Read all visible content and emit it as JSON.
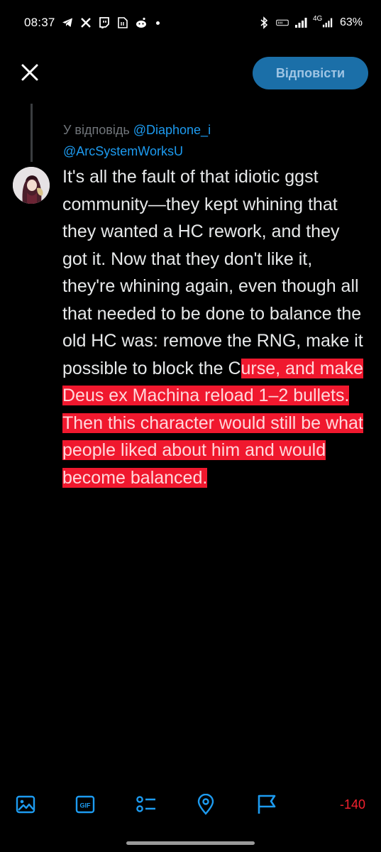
{
  "status": {
    "time": "08:37",
    "network": "4G",
    "battery": "63%",
    "left_icons": [
      "telegram-icon",
      "x-icon",
      "twitch-icon",
      "sim-icon",
      "reddit-icon"
    ],
    "right_icons": [
      "bluetooth-icon",
      "volte-icon",
      "signal-icon",
      "mobile-data-icon",
      "battery-icon"
    ]
  },
  "top_bar": {
    "close_icon": "close-icon",
    "reply_label": "Відповісти"
  },
  "reply_context": {
    "prefix": "У відповідь",
    "mention_1": "@Diaphone_i",
    "mention_2": "@ArcSystemWorksU"
  },
  "composer": {
    "text_plain": "It's all the fault of that idiotic ggst community—they kept whining that they wanted a HC rework, and they got it. Now that they don't like it, they're whining again, even though all that needed to be done to balance the old HC was: remove the RNG, make it possible to block the C",
    "text_highlight": "urse, and make Deus ex Machina reload 1–2 bullets. Then this character would still be what people liked about him and would become balanced.",
    "highlight_color": "#f0182e"
  },
  "toolbar": {
    "tools": [
      "image-icon",
      "gif-icon",
      "poll-icon",
      "location-icon",
      "flag-icon"
    ],
    "char_count": "-140",
    "char_count_color": "#f4212e"
  },
  "colors": {
    "background": "#000000",
    "accent": "#1d9bf0",
    "reply_button_bg": "#1b6fa8",
    "muted": "#71767b"
  }
}
